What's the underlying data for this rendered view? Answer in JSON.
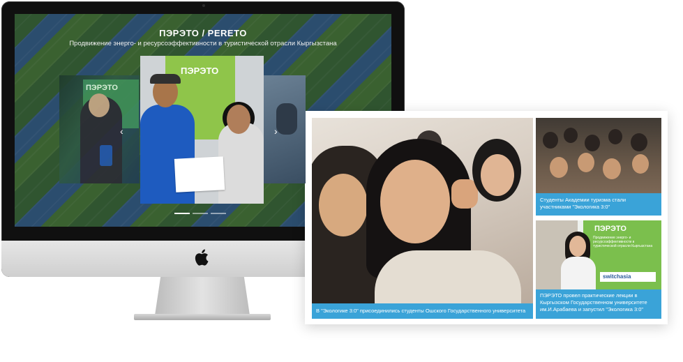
{
  "site": {
    "title": "ПЭРЭТО / PERETO",
    "subtitle": "Продвижение энерго- и ресурсоэффективности в туристической отрасли Кыргызстана"
  },
  "slider": {
    "prev_arrow": "‹",
    "next_arrow": "›",
    "dots": [
      {
        "active": true
      },
      {
        "active": false
      },
      {
        "active": false
      }
    ],
    "slides": [
      {
        "banner_text": "ПЭРЭТО"
      },
      {
        "banner_text": "ПЭРЭТО"
      },
      {
        "banner_text": ""
      }
    ]
  },
  "news": {
    "main": {
      "caption": "В \"Экологике 3:0\" присоединились студенты Ошского Государственного университета"
    },
    "top": {
      "caption": "Студенты Академии туризма стали участниками \"Экологика 3:0\""
    },
    "bottom": {
      "caption": "ПЭРЭТО провел практические лекции в Кыргызском Государственном университете им.И.Арабаева и запустил \"Экологика 3:0\"",
      "banner_title": "ПЭРЭТО",
      "banner_sub": "Продвижение энерго- и ресурсоэффективности в туристической отрасли Кыргызстана",
      "sponsor": "switchasia"
    }
  },
  "colors": {
    "caption_bg": "#3aa3d8",
    "banner_green": "#7bbf4d"
  }
}
